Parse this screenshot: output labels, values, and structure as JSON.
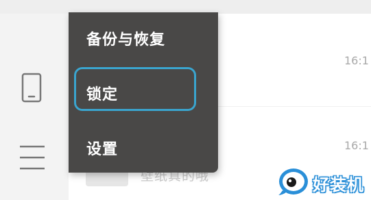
{
  "menu": {
    "items": [
      {
        "label": "备份与恢复"
      },
      {
        "label": "锁定"
      },
      {
        "label": "设置"
      }
    ]
  },
  "list": {
    "times": [
      "16:1",
      "16:1"
    ],
    "partial_item_text": "壁纸真的哦"
  },
  "sidebar": {
    "icons": [
      "phone-icon",
      "hamburger-menu-icon"
    ]
  },
  "watermark": {
    "text": "好装机"
  },
  "colors": {
    "menu_background": "#494847",
    "highlight_border": "#3aa5cf",
    "time_text": "#a9a9a9"
  }
}
